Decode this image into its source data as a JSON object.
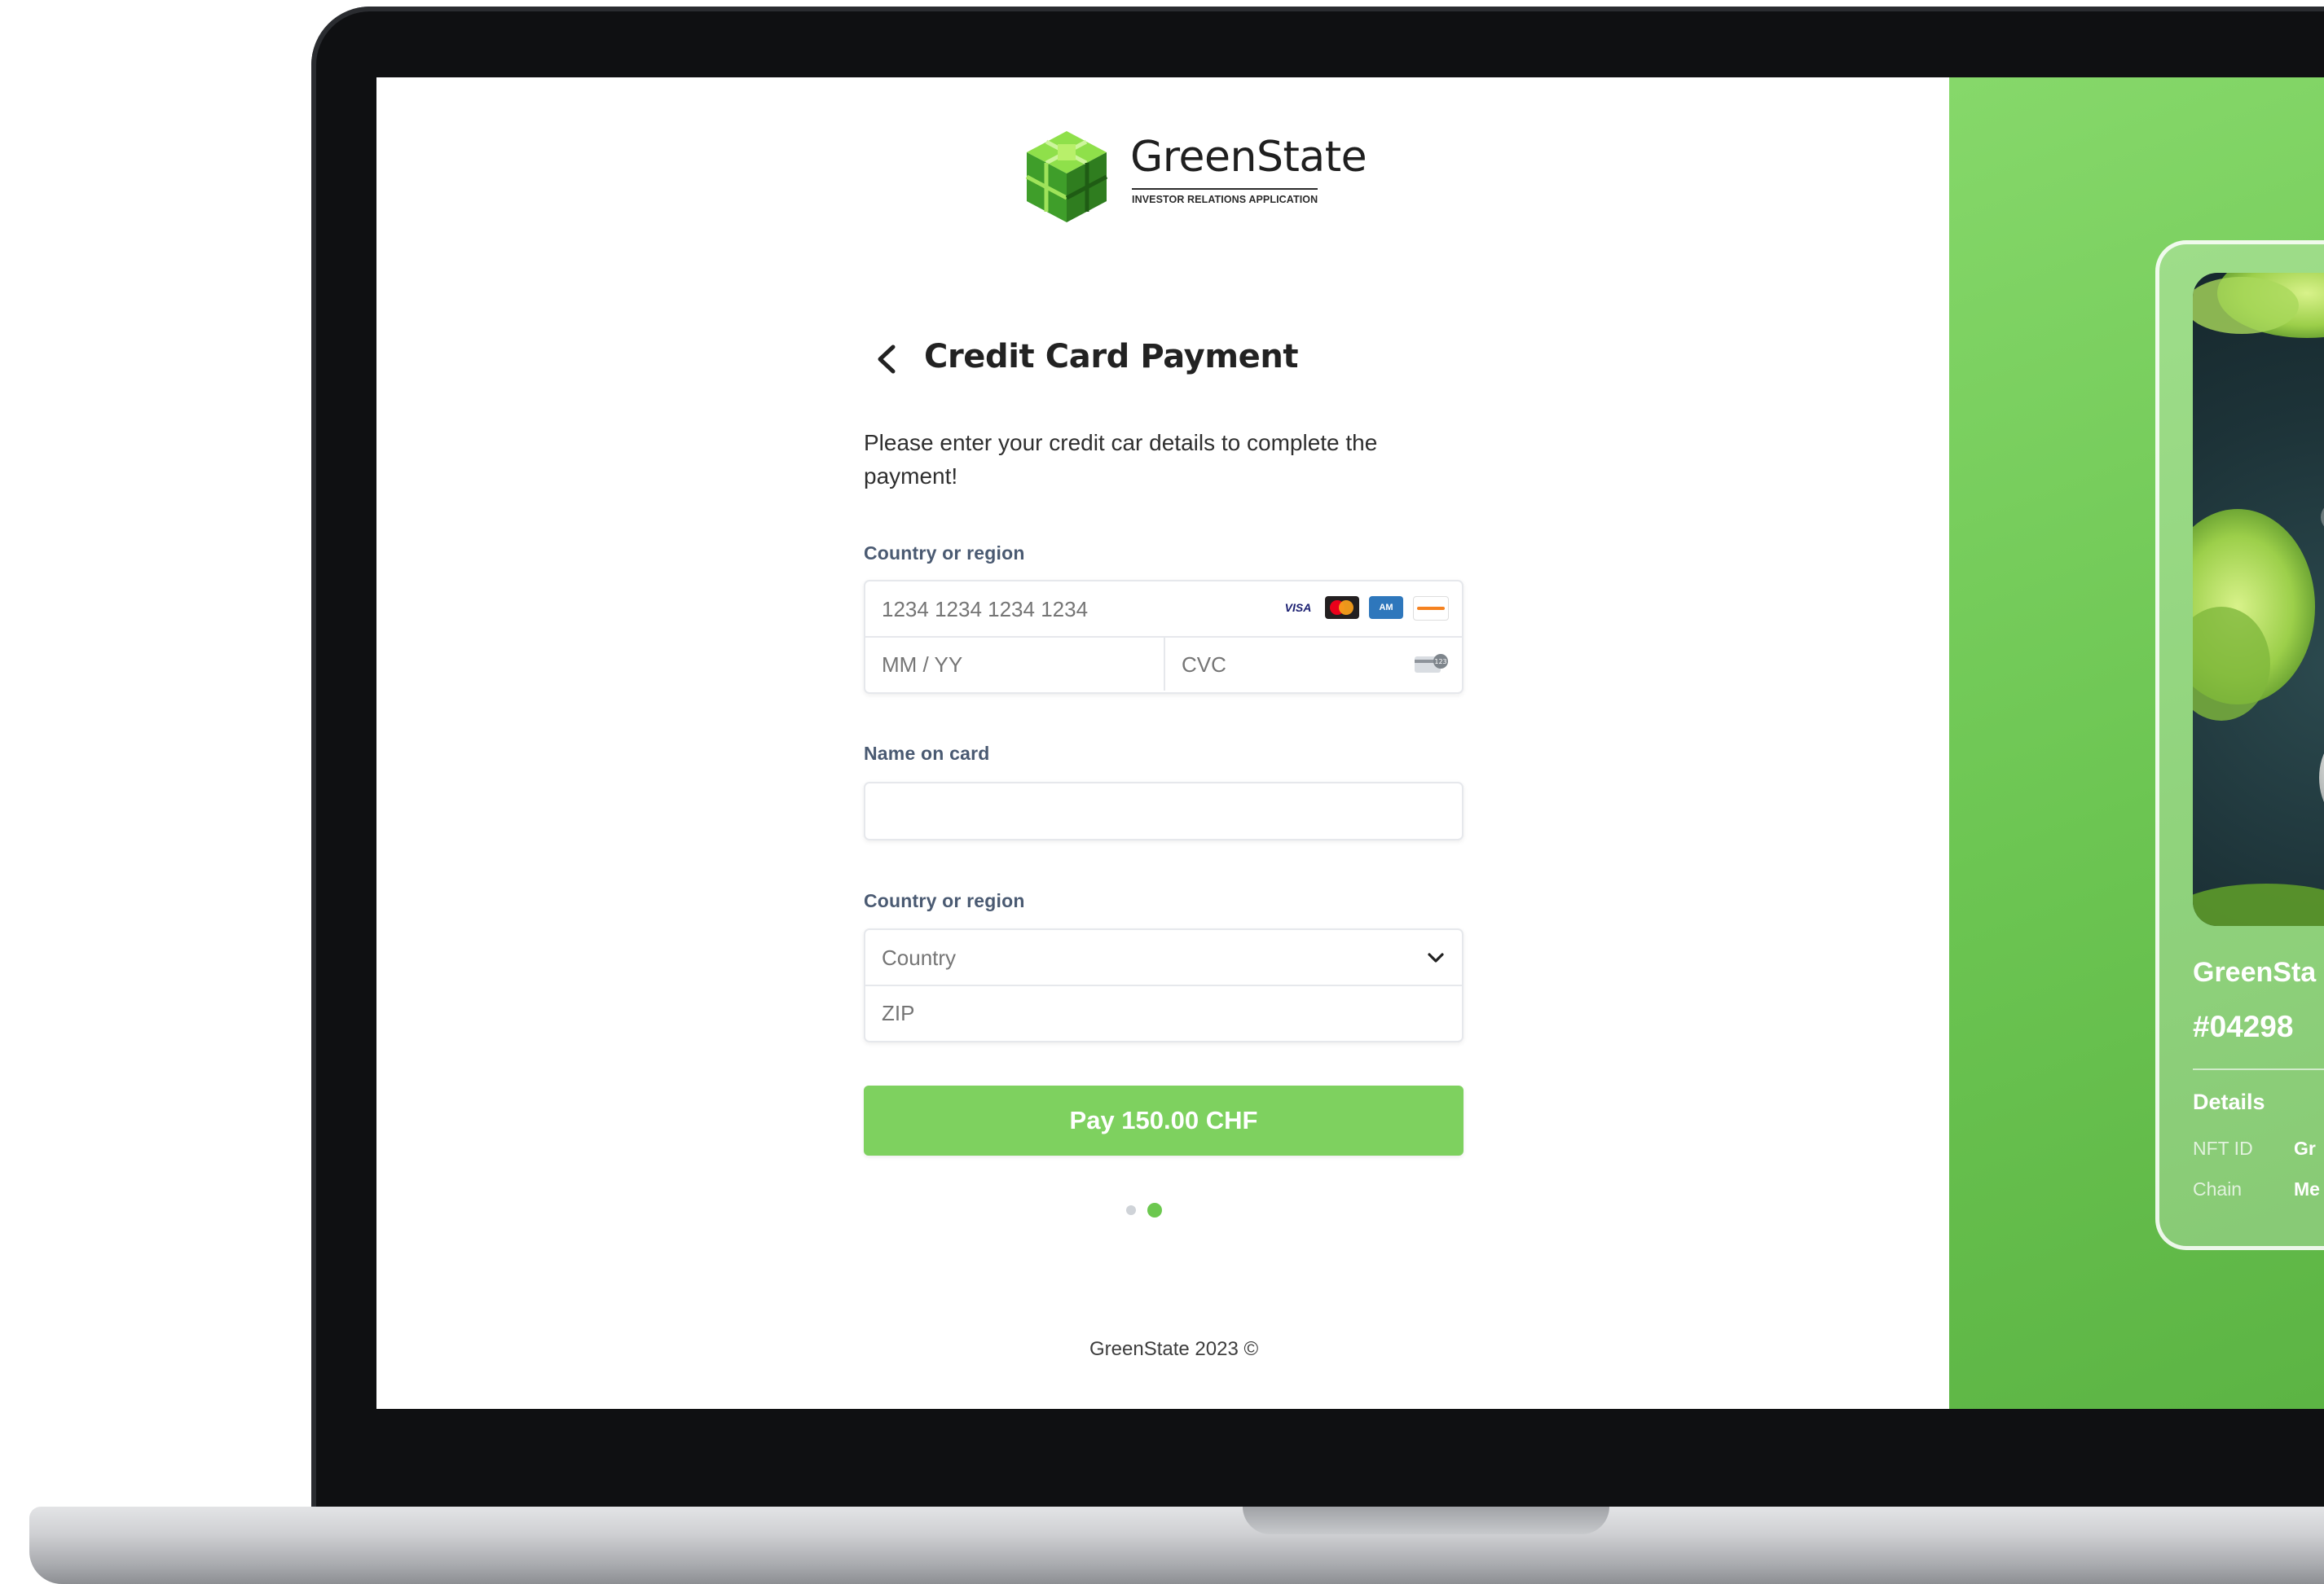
{
  "logo": {
    "name": "GreenState",
    "tagline": "INVESTOR RELATIONS APPLICATION"
  },
  "page": {
    "title": "Credit Card Payment",
    "intro": "Please enter your credit car details to complete the payment!"
  },
  "card_section": {
    "label": "Country or region",
    "card_number_placeholder": "1234 1234 1234 1234",
    "expiry_placeholder": "MM / YY",
    "cvc_placeholder": "CVC",
    "brands": [
      "VISA",
      "Mastercard",
      "Amex",
      "Discover"
    ]
  },
  "name_section": {
    "label": "Name on card",
    "value": ""
  },
  "region_section": {
    "label": "Country or region",
    "country_placeholder": "Country",
    "zip_placeholder": "ZIP"
  },
  "pay_button": {
    "label": "Pay 150.00 CHF"
  },
  "pagination": {
    "total": 2,
    "active": 2
  },
  "footer": {
    "text": "GreenState 2023 ©"
  },
  "nft": {
    "title": "GreenSta",
    "number": "#04298",
    "details_label": "Details",
    "rows": [
      {
        "key": "NFT ID",
        "value": "Gr"
      },
      {
        "key": "Chain",
        "value": "Me"
      }
    ]
  },
  "colors": {
    "accent": "#7ed15f",
    "panel_green": "#6cc552",
    "label": "#4a5a72"
  }
}
